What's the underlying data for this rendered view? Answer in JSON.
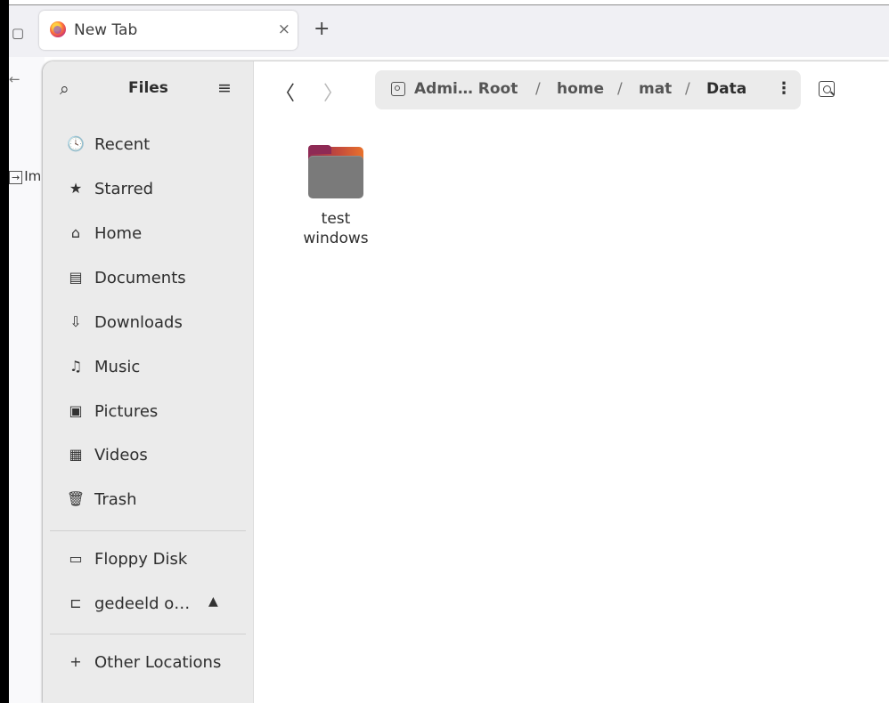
{
  "browser": {
    "tab": {
      "title": "New Tab",
      "close": "×"
    },
    "new_tab": "+",
    "back_icon": "←",
    "bookmark_label": "Im"
  },
  "files_app": {
    "title": "Files",
    "search_icon": "search-icon",
    "menu_icon": "hamburger-menu-icon",
    "sidebar": {
      "places": [
        {
          "icon": "clock-icon",
          "glyph": "🕓",
          "label": "Recent"
        },
        {
          "icon": "star-icon",
          "glyph": "★",
          "label": "Starred"
        },
        {
          "icon": "home-icon",
          "glyph": "⌂",
          "label": "Home"
        },
        {
          "icon": "document-icon",
          "glyph": "▤",
          "label": "Documents"
        },
        {
          "icon": "download-icon",
          "glyph": "⇩",
          "label": "Downloads"
        },
        {
          "icon": "music-icon",
          "glyph": "♫",
          "label": "Music"
        },
        {
          "icon": "picture-icon",
          "glyph": "▣",
          "label": "Pictures"
        },
        {
          "icon": "video-icon",
          "glyph": "▦",
          "label": "Videos"
        },
        {
          "icon": "trash-icon",
          "glyph": "🗑",
          "label": "Trash"
        }
      ],
      "devices": [
        {
          "icon": "floppy-disk-icon",
          "glyph": "▭",
          "label": "Floppy Disk"
        },
        {
          "icon": "network-folder-icon",
          "glyph": "⊏",
          "label": "gedeeld o…",
          "eject": "▲"
        }
      ],
      "other": {
        "icon": "plus-icon",
        "glyph": "+",
        "label": "Other Locations"
      }
    },
    "header": {
      "back": "〈",
      "forward": "〉",
      "path": {
        "root": "Admi… Root",
        "segments": [
          "home",
          "mat",
          "Data"
        ],
        "separator": "/",
        "more": "⋮"
      },
      "search_icon": "folder-search-icon",
      "more": "⋮"
    },
    "items": [
      {
        "name_line1": "test",
        "name_line2": "windows",
        "type": "folder"
      }
    ]
  },
  "colors": {
    "sidebar_bg": "#ebebeb",
    "pathbar_bg": "#ebebeb",
    "folder_accent": "#e8722c",
    "folder_front": "#7a7a7a"
  }
}
